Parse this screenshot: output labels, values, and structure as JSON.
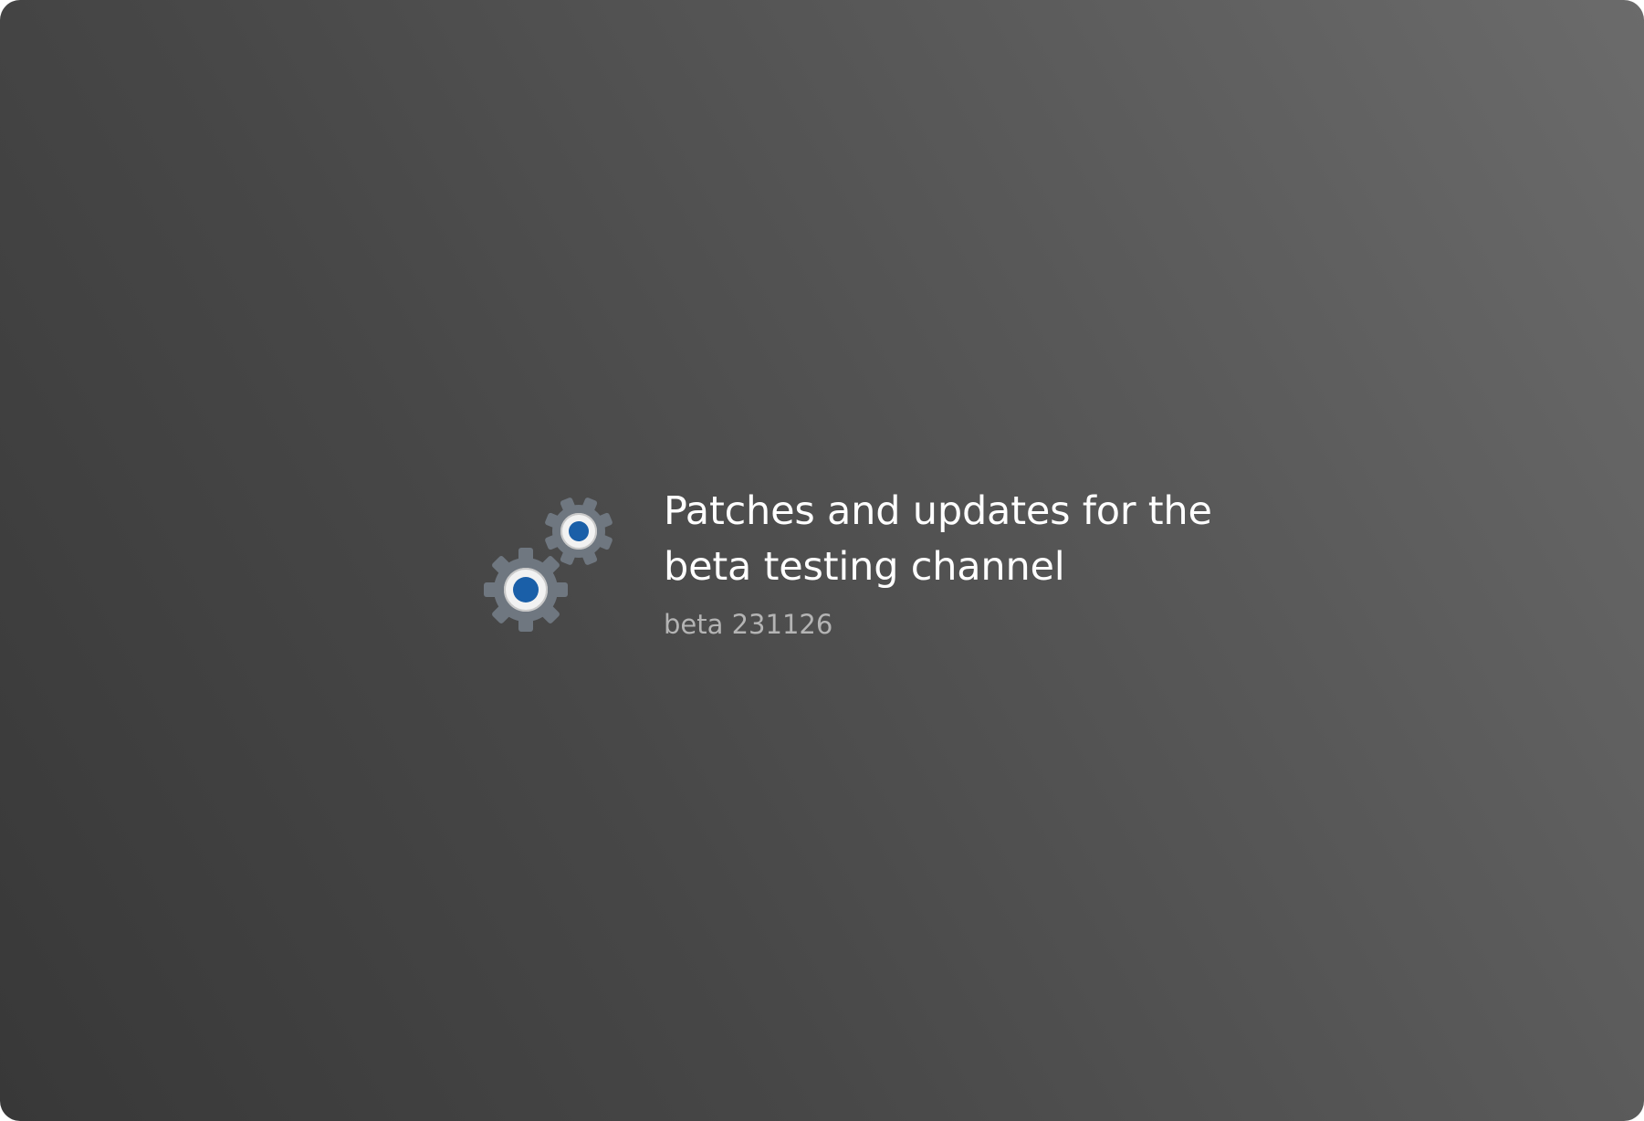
{
  "notification": {
    "title": "Patches and updates for the beta testing channel",
    "subtitle": "beta 231126",
    "icon": "gears-icon"
  },
  "colors": {
    "gear_body": "#6f7780",
    "gear_ring": "#f2f2f2",
    "gear_center": "#1a5fa8",
    "title": "#ffffff",
    "subtitle": "#b4b4b4"
  }
}
